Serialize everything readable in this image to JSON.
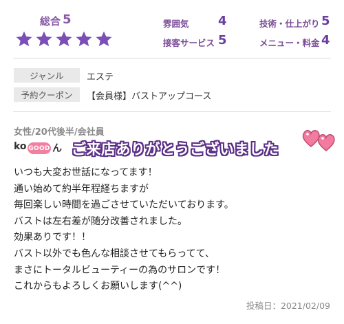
{
  "ratings": {
    "overall_label": "総合",
    "overall_value": "5",
    "star_count": 5,
    "star_color": "#7b4fb5",
    "items": [
      {
        "label": "雰囲気",
        "value": "4"
      },
      {
        "label": "技術・仕上がり",
        "value": "5"
      },
      {
        "label": "接客サービス",
        "value": "5"
      },
      {
        "label": "メニュー・料金",
        "value": "4"
      }
    ]
  },
  "info": {
    "genre_label": "ジャンル",
    "genre_value": "エステ",
    "coupon_label": "予約クーポン",
    "coupon_value": "【会員様】バストアップコース"
  },
  "review": {
    "reviewer_meta": "女性/20代後半/会社員",
    "name": "ko",
    "name_suffix": "ん",
    "badge": "GOOD",
    "overlay_banner": "ご来店ありがとうございました",
    "lines": [
      "いつも大変お世話になってます！",
      "通い始めて約半年程経ちますが",
      "毎回楽しい時間を過ごさせていただいております。",
      "バストは左右差が随分改善されました。",
      "効果ありです！！",
      "バスト以外でも色んな相談させてもらってて、",
      "まさにトータルビューティーの為のサロンです！",
      "これからもよろしくお願いします(^^)"
    ],
    "posted": "投稿日：2021/02/09"
  },
  "icons": {
    "star": "star-icon",
    "hearts": "hearts-icon",
    "good": "good-thumb-icon"
  }
}
